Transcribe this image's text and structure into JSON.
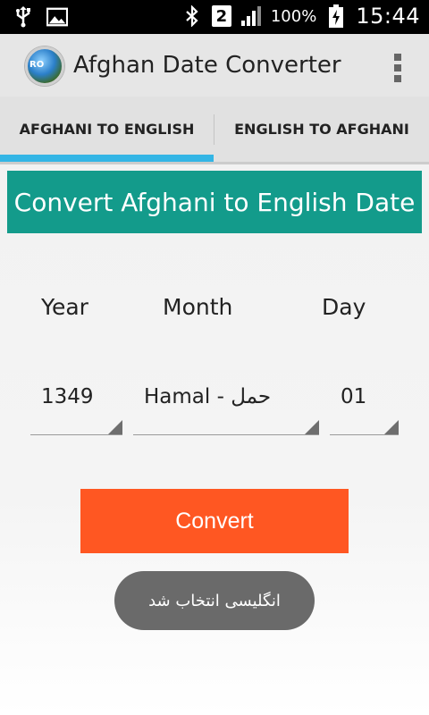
{
  "status_bar": {
    "icons": [
      "usb-icon",
      "image-icon",
      "bluetooth-icon",
      "sim-2-icon",
      "signal-icon",
      "battery-charging-icon"
    ],
    "sim_badge": "2",
    "battery_percent": "100%",
    "clock": "15:44"
  },
  "action_bar": {
    "title": "Afghan Date Converter",
    "logo_text": "RO"
  },
  "tabs": [
    {
      "label": "AFGHANI TO ENGLISH",
      "selected": true
    },
    {
      "label": "ENGLISH TO AFGHANI",
      "selected": false
    }
  ],
  "main": {
    "header": "Convert Afghani to English Date",
    "labels": {
      "year": "Year",
      "month": "Month",
      "day": "Day"
    },
    "spinners": {
      "year": "1349",
      "month": "Hamal - حمل",
      "day": "01"
    },
    "convert_label": "Convert",
    "toast": "انگلیسی انتخاب شد"
  },
  "colors": {
    "header_bg": "#139b8b",
    "convert_bg": "#ff5722",
    "tab_indicator": "#33b5e5"
  }
}
